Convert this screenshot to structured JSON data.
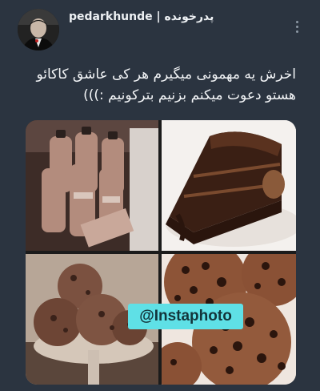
{
  "post": {
    "author_display": "pedarkhunde | پدرخونده",
    "text": "اخرش یه مهمونی میگیرم هر کی عاشق کاکائو هستو دعوت میکنم بزنیم بترکونیم :)))",
    "more_icon": "more-vertical-icon"
  },
  "media": {
    "watermark": "@Instaphoto",
    "watermark_color": "#5fe0e6",
    "tiles": [
      {
        "name": "chocolate-milk-bottles"
      },
      {
        "name": "chocolate-cake-slice"
      },
      {
        "name": "chocolate-ice-cream-scoops"
      },
      {
        "name": "chocolate-chip-cookies"
      }
    ]
  },
  "colors": {
    "background": "#2b3440",
    "text": "#f1f3f5"
  }
}
